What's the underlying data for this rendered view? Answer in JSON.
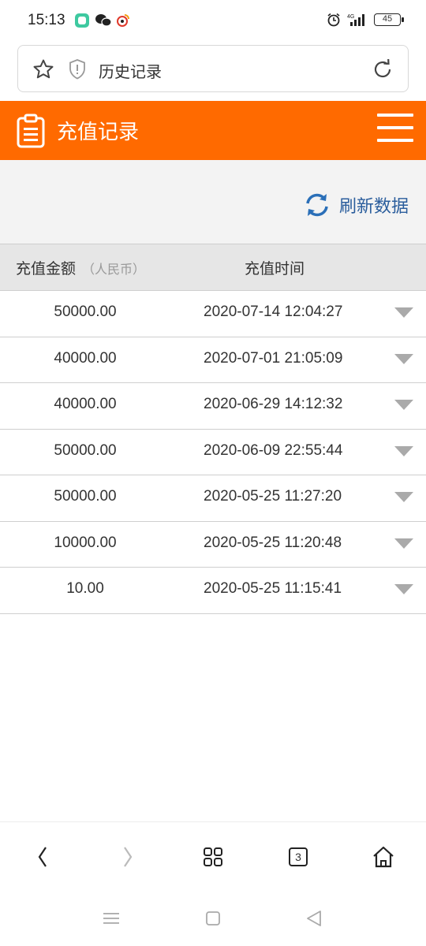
{
  "status_bar": {
    "time": "15:13",
    "network": "4G",
    "battery": "45"
  },
  "address_bar": {
    "title": "历史记录"
  },
  "header": {
    "title": "充值记录"
  },
  "toolbar": {
    "refresh_label": "刷新数据"
  },
  "table": {
    "columns": {
      "amount": "充值金额",
      "amount_unit": "（人民币）",
      "time": "充值时间"
    },
    "rows": [
      {
        "amount": "50000.00",
        "time": "2020-07-14 12:04:27"
      },
      {
        "amount": "40000.00",
        "time": "2020-07-01 21:05:09"
      },
      {
        "amount": "40000.00",
        "time": "2020-06-29 14:12:32"
      },
      {
        "amount": "50000.00",
        "time": "2020-06-09 22:55:44"
      },
      {
        "amount": "50000.00",
        "time": "2020-05-25 11:27:20"
      },
      {
        "amount": "10000.00",
        "time": "2020-05-25 11:20:48"
      },
      {
        "amount": "10.00",
        "time": "2020-05-25 11:15:41"
      }
    ]
  },
  "bottom_nav": {
    "tab_count": "3"
  },
  "colors": {
    "header_bg": "#ff6a00",
    "refresh_text": "#2a5d9c"
  }
}
